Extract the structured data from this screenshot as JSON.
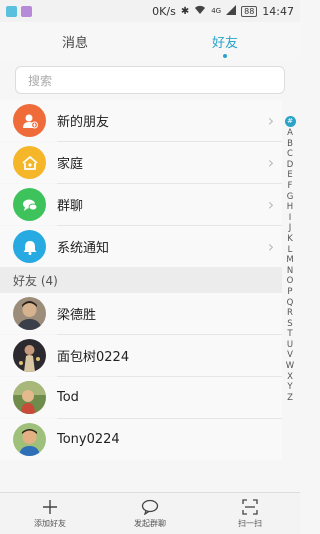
{
  "status_bar": {
    "speed": "0K/s",
    "network": "4G",
    "battery": "88",
    "time": "14:47"
  },
  "tabs": [
    {
      "label": "消息",
      "active": false
    },
    {
      "label": "好友",
      "active": true
    }
  ],
  "search": {
    "placeholder": "搜索"
  },
  "menu_items": [
    {
      "label": "新的朋友",
      "icon": "add-user-icon",
      "color": "#f06b3a"
    },
    {
      "label": "家庭",
      "icon": "home-icon",
      "color": "#f5b62a"
    },
    {
      "label": "群聊",
      "icon": "chat-bubbles-icon",
      "color": "#3ec35c"
    },
    {
      "label": "系统通知",
      "icon": "bell-icon",
      "color": "#27a9e1"
    }
  ],
  "friends_section": {
    "header": "好友 (4)"
  },
  "friends": [
    {
      "name": "梁德胜"
    },
    {
      "name": "面包树0224"
    },
    {
      "name": "Tod"
    },
    {
      "name": "Tony0224"
    }
  ],
  "index_letters": [
    "#",
    "A",
    "B",
    "C",
    "D",
    "E",
    "F",
    "G",
    "H",
    "I",
    "J",
    "K",
    "L",
    "M",
    "N",
    "O",
    "P",
    "Q",
    "R",
    "S",
    "T",
    "U",
    "V",
    "W",
    "X",
    "Y",
    "Z"
  ],
  "bottom_bar": {
    "add_friend": "添加好友",
    "start_group": "发起群聊",
    "scan": "扫一扫"
  },
  "colors": {
    "accent": "#2aa3c9"
  }
}
